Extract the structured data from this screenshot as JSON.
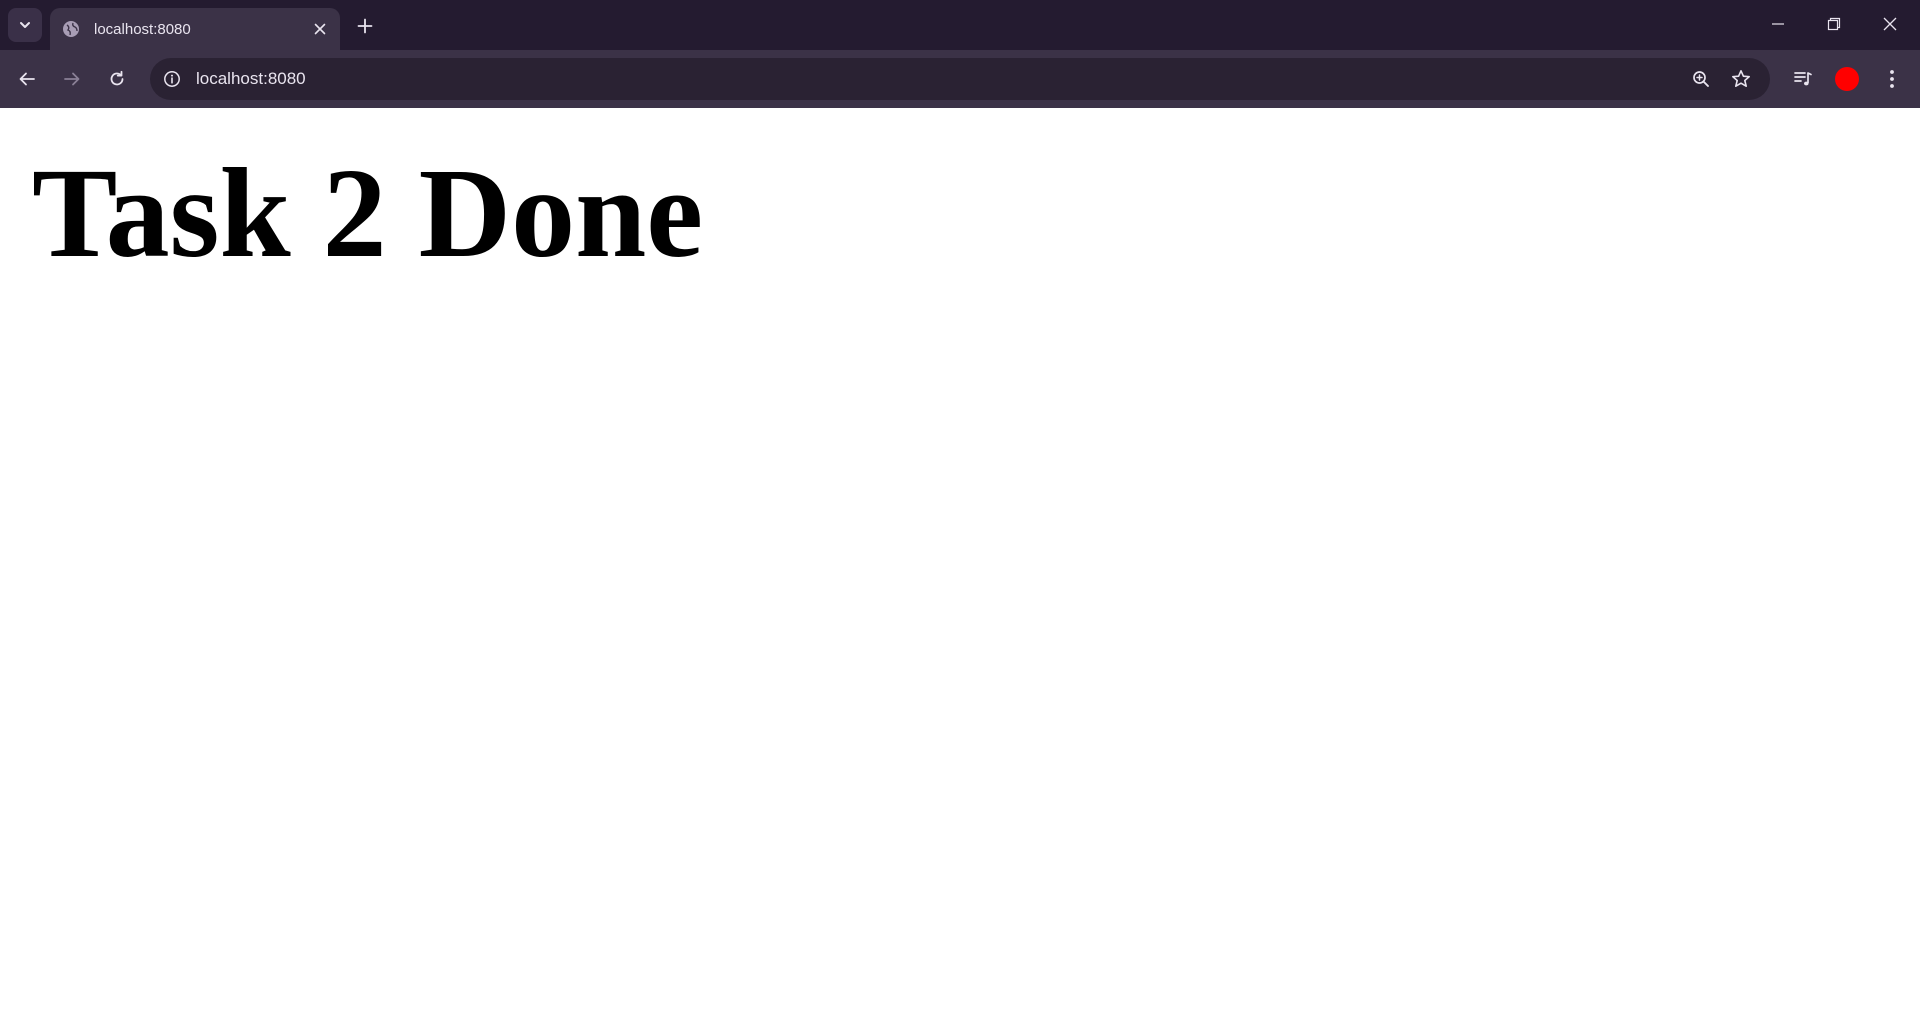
{
  "browser": {
    "tab": {
      "title": "localhost:8080",
      "favicon": "globe-icon"
    },
    "address_bar": {
      "url": "localhost:8080"
    },
    "profile": {
      "avatar_color": "#ff0000"
    },
    "theme": {
      "tabstrip_bg": "#241b30",
      "toolbar_bg": "#3b3247",
      "omnibox_bg": "#2a2233"
    },
    "icons": [
      "tab-search-icon",
      "globe-icon",
      "close-icon",
      "plus-icon",
      "minimize-icon",
      "restore-icon",
      "window-close-icon",
      "back-arrow-icon",
      "forward-arrow-icon",
      "reload-icon",
      "info-icon",
      "zoom-icon",
      "star-icon",
      "media-control-icon",
      "kebab-menu-icon"
    ]
  },
  "page": {
    "heading": "Task 2 Done"
  }
}
